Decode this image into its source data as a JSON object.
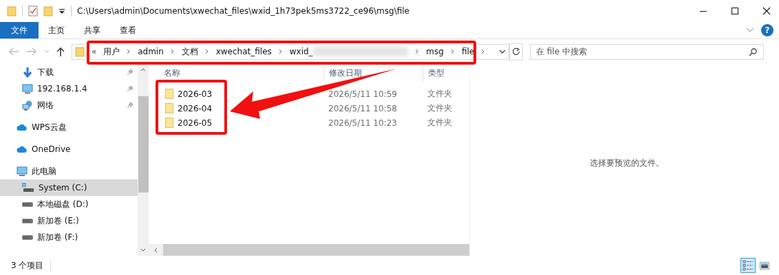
{
  "window": {
    "title": "C:\\Users\\admin\\Documents\\xwechat_files\\wxid_1h73pek5ms3722_ce96\\msg\\file"
  },
  "ribbon": {
    "tabs": [
      {
        "label": "文件",
        "selected": true
      },
      {
        "label": "主页",
        "selected": false
      },
      {
        "label": "共享",
        "selected": false
      },
      {
        "label": "查看",
        "selected": false
      }
    ],
    "help_label": "?"
  },
  "address_bar": {
    "overflow": "«",
    "crumbs": [
      {
        "label": "用户",
        "blurred": false
      },
      {
        "label": "admin",
        "blurred": false
      },
      {
        "label": "文档",
        "blurred": false
      },
      {
        "label": "xwechat_files",
        "blurred": false
      },
      {
        "label": "wxid_",
        "blurred": true
      },
      {
        "label": "msg",
        "blurred": false
      },
      {
        "label": "file",
        "blurred": false
      }
    ]
  },
  "search": {
    "placeholder": "在 file 中搜索"
  },
  "sidebar": {
    "items": [
      {
        "kind": "download",
        "label": "下载",
        "pinned": true,
        "selected": false
      },
      {
        "kind": "monitor",
        "label": "192.168.1.4",
        "pinned": true,
        "selected": false
      },
      {
        "kind": "network",
        "label": "网络",
        "pinned": true,
        "selected": false
      },
      {
        "kind": "cloud",
        "label": "WPS云盘",
        "pinned": false,
        "selected": false
      },
      {
        "kind": "cloud",
        "label": "OneDrive",
        "pinned": false,
        "selected": false
      },
      {
        "kind": "pc",
        "label": "此电脑",
        "pinned": false,
        "selected": false,
        "children": [
          {
            "kind": "system-drive",
            "label": "System (C:)",
            "selected": true
          },
          {
            "kind": "drive",
            "label": "本地磁盘 (D:)",
            "selected": false
          },
          {
            "kind": "drive",
            "label": "新加卷 (E:)",
            "selected": false
          },
          {
            "kind": "drive",
            "label": "新加卷 (F:)",
            "selected": false
          }
        ]
      }
    ]
  },
  "file_list": {
    "columns": [
      "名称",
      "修改日期",
      "类型"
    ],
    "rows": [
      {
        "name": "2026-03",
        "modified": "2026/5/11 10:59",
        "type": "文件夹"
      },
      {
        "name": "2026-04",
        "modified": "2026/5/11 10:58",
        "type": "文件夹"
      },
      {
        "name": "2026-05",
        "modified": "2026/5/11 10:23",
        "type": "文件夹"
      }
    ]
  },
  "preview": {
    "message": "选择要预览的文件。"
  },
  "status_bar": {
    "item_count": "3 个项目",
    "views": [
      {
        "kind": "details",
        "selected": true
      },
      {
        "kind": "thumbnails",
        "selected": false
      }
    ]
  }
}
